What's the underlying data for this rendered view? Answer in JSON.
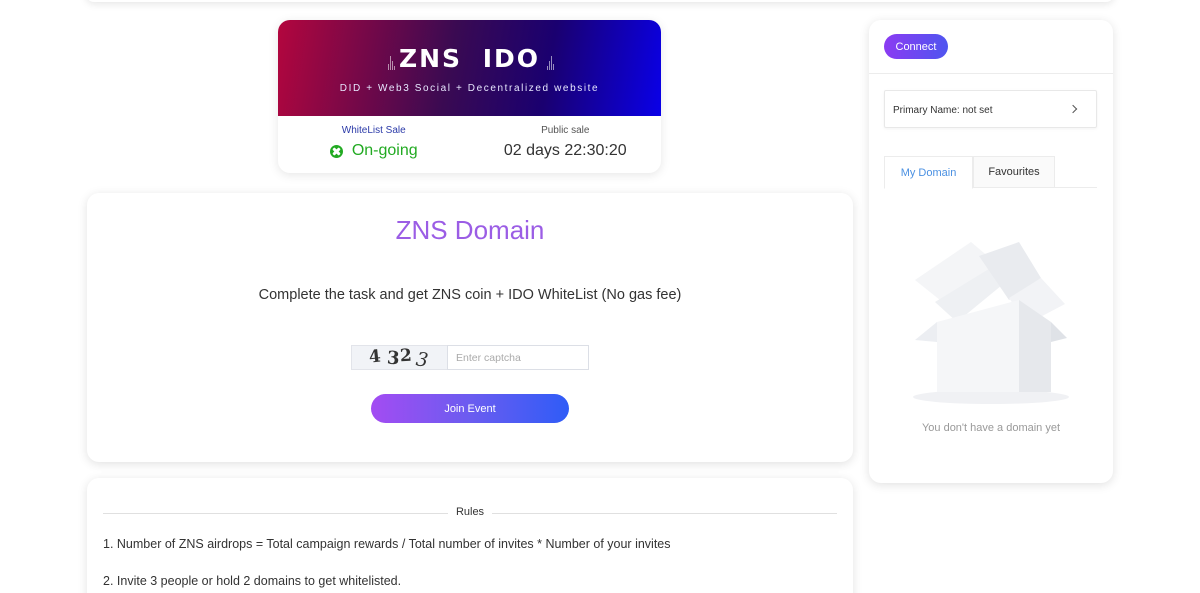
{
  "ido": {
    "title": "ZNS IDO",
    "subtitle": "DID + Web3 Social + Decentralized website",
    "whitelist_label": "WhiteList Sale",
    "whitelist_status": "On-going",
    "public_label": "Public sale",
    "public_countdown": "02 days 22:30:20"
  },
  "domain": {
    "title": "ZNS Domain",
    "description": "Complete the task and get ZNS coin + IDO WhiteList (No gas fee)",
    "captcha_chars": [
      "4",
      "3",
      "2",
      "3"
    ],
    "captcha_placeholder": "Enter captcha",
    "join_label": "Join Event"
  },
  "rules": {
    "heading": "Rules",
    "items": [
      "1. Number of ZNS airdrops = Total campaign rewards / Total number of invites * Number of your invites",
      "2. Invite 3 people or hold 2 domains to get whitelisted."
    ]
  },
  "sidebar": {
    "connect_label": "Connect",
    "primary_name": "Primary Name: not set",
    "tabs": [
      "My Domain",
      "Favourites"
    ],
    "empty_text": "You don't have a domain yet"
  },
  "colors": {
    "accent_purple": "#9b5de5",
    "status_green": "#22aa22",
    "tab_active_blue": "#4a90e2"
  }
}
